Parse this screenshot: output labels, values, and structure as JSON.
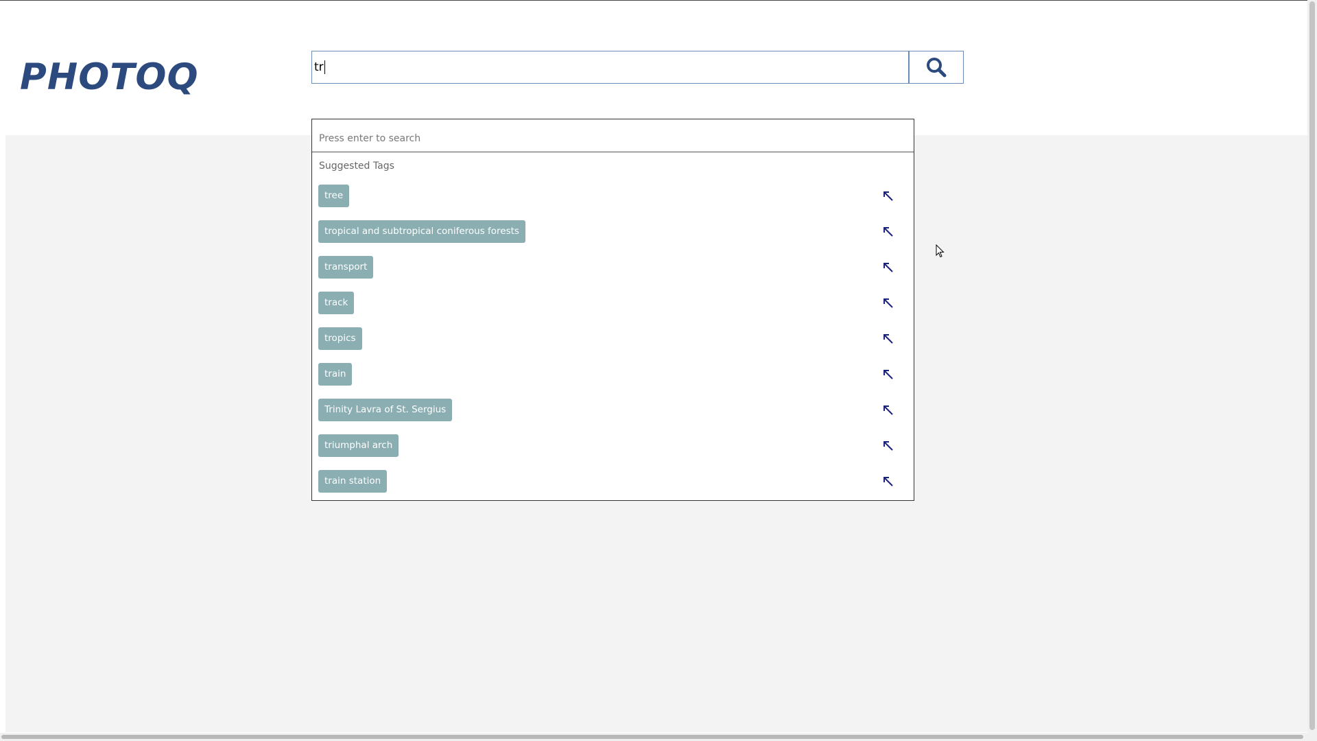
{
  "app": {
    "logo": "PHOTOQ"
  },
  "search": {
    "value": "tr",
    "button_icon": "search-icon"
  },
  "dropdown": {
    "hint": "Press enter to search",
    "section_title": "Suggested Tags",
    "tags": [
      {
        "label": "tree",
        "icon": "arrow-up-left-icon"
      },
      {
        "label": "tropical and subtropical coniferous forests",
        "icon": "arrow-up-left-icon"
      },
      {
        "label": "transport",
        "icon": "arrow-up-left-icon"
      },
      {
        "label": "track",
        "icon": "arrow-up-left-icon"
      },
      {
        "label": "tropics",
        "icon": "arrow-up-left-icon"
      },
      {
        "label": "train",
        "icon": "arrow-up-left-icon"
      },
      {
        "label": "Trinity Lavra of St. Sergius",
        "icon": "arrow-up-left-icon"
      },
      {
        "label": "triumphal arch",
        "icon": "arrow-up-left-icon"
      },
      {
        "label": "train station",
        "icon": "arrow-up-left-icon"
      }
    ]
  },
  "colors": {
    "brand": "#2c4a7e",
    "tag_background": "#8aaeb2",
    "arrow": "#1a237e",
    "content_background": "#f3f3f3"
  }
}
